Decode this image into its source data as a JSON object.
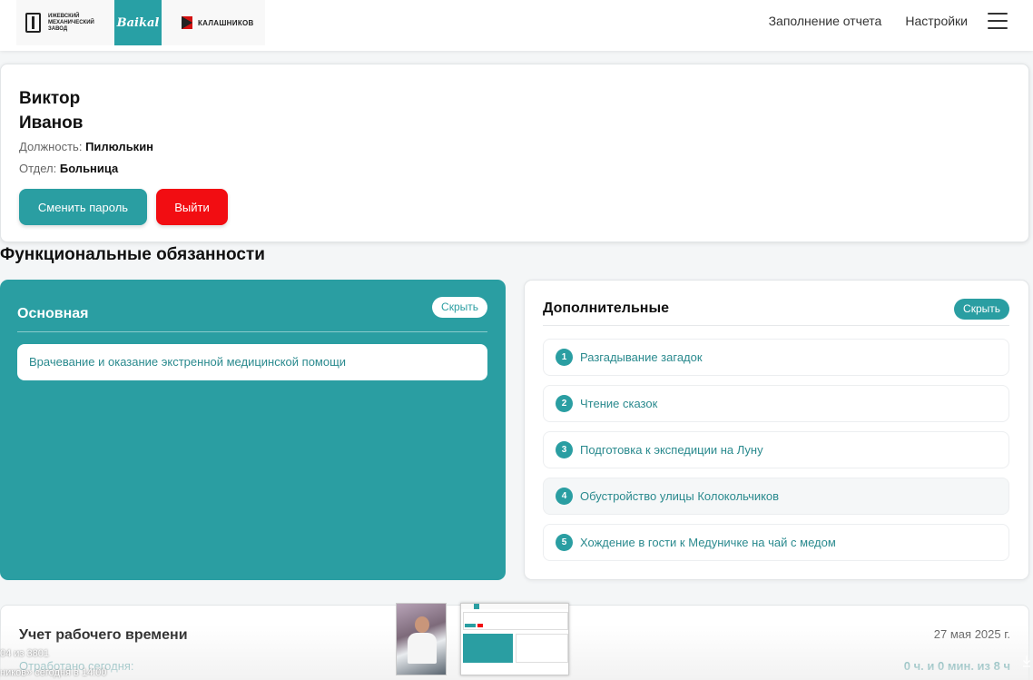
{
  "header": {
    "logo_imz": "ИЖЕВСКИЙ\nМЕХАНИЧЕСКИЙ\nЗАВОД",
    "logo_baikal": "Baikal",
    "logo_kalashnikov": "КАЛАШНИКОВ",
    "nav": {
      "report": "Заполнение отчета",
      "settings": "Настройки"
    }
  },
  "profile": {
    "first_name": "Виктор",
    "last_name": "Иванов",
    "position_label": "Должность:",
    "position_value": "Пилюлькин",
    "department_label": "Отдел:",
    "department_value": "Больница",
    "change_password": "Сменить пароль",
    "logout": "Выйти"
  },
  "duties": {
    "title": "Функциональные обязанности",
    "main": {
      "title": "Основная",
      "hide": "Скрыть",
      "items": [
        "Врачевание и оказание экстренной медицинской помощи"
      ]
    },
    "additional": {
      "title": "Дополнительные",
      "hide": "Скрыть",
      "items": [
        {
          "num": "1",
          "label": "Разгадывание загадок"
        },
        {
          "num": "2",
          "label": "Чтение сказок"
        },
        {
          "num": "3",
          "label": "Подготовка к экспедиции на Луну"
        },
        {
          "num": "4",
          "label": "Обустройство улицы Колокольчиков"
        },
        {
          "num": "5",
          "label": "Хождение в гости к Медуничке на чай с медом"
        }
      ]
    }
  },
  "timesheet": {
    "title": "Учет рабочего времени",
    "date": "27 мая 2025 г.",
    "worked_label": "Отработано сегодня:",
    "worked_value": "0 ч. и 0 мин. из 8 ч"
  },
  "overlay": {
    "counter": "04 из 3801",
    "subtitle": "ников»  сегодня в 14:00"
  },
  "colors": {
    "accent": "#2a9ea2",
    "danger": "#f20d12"
  }
}
